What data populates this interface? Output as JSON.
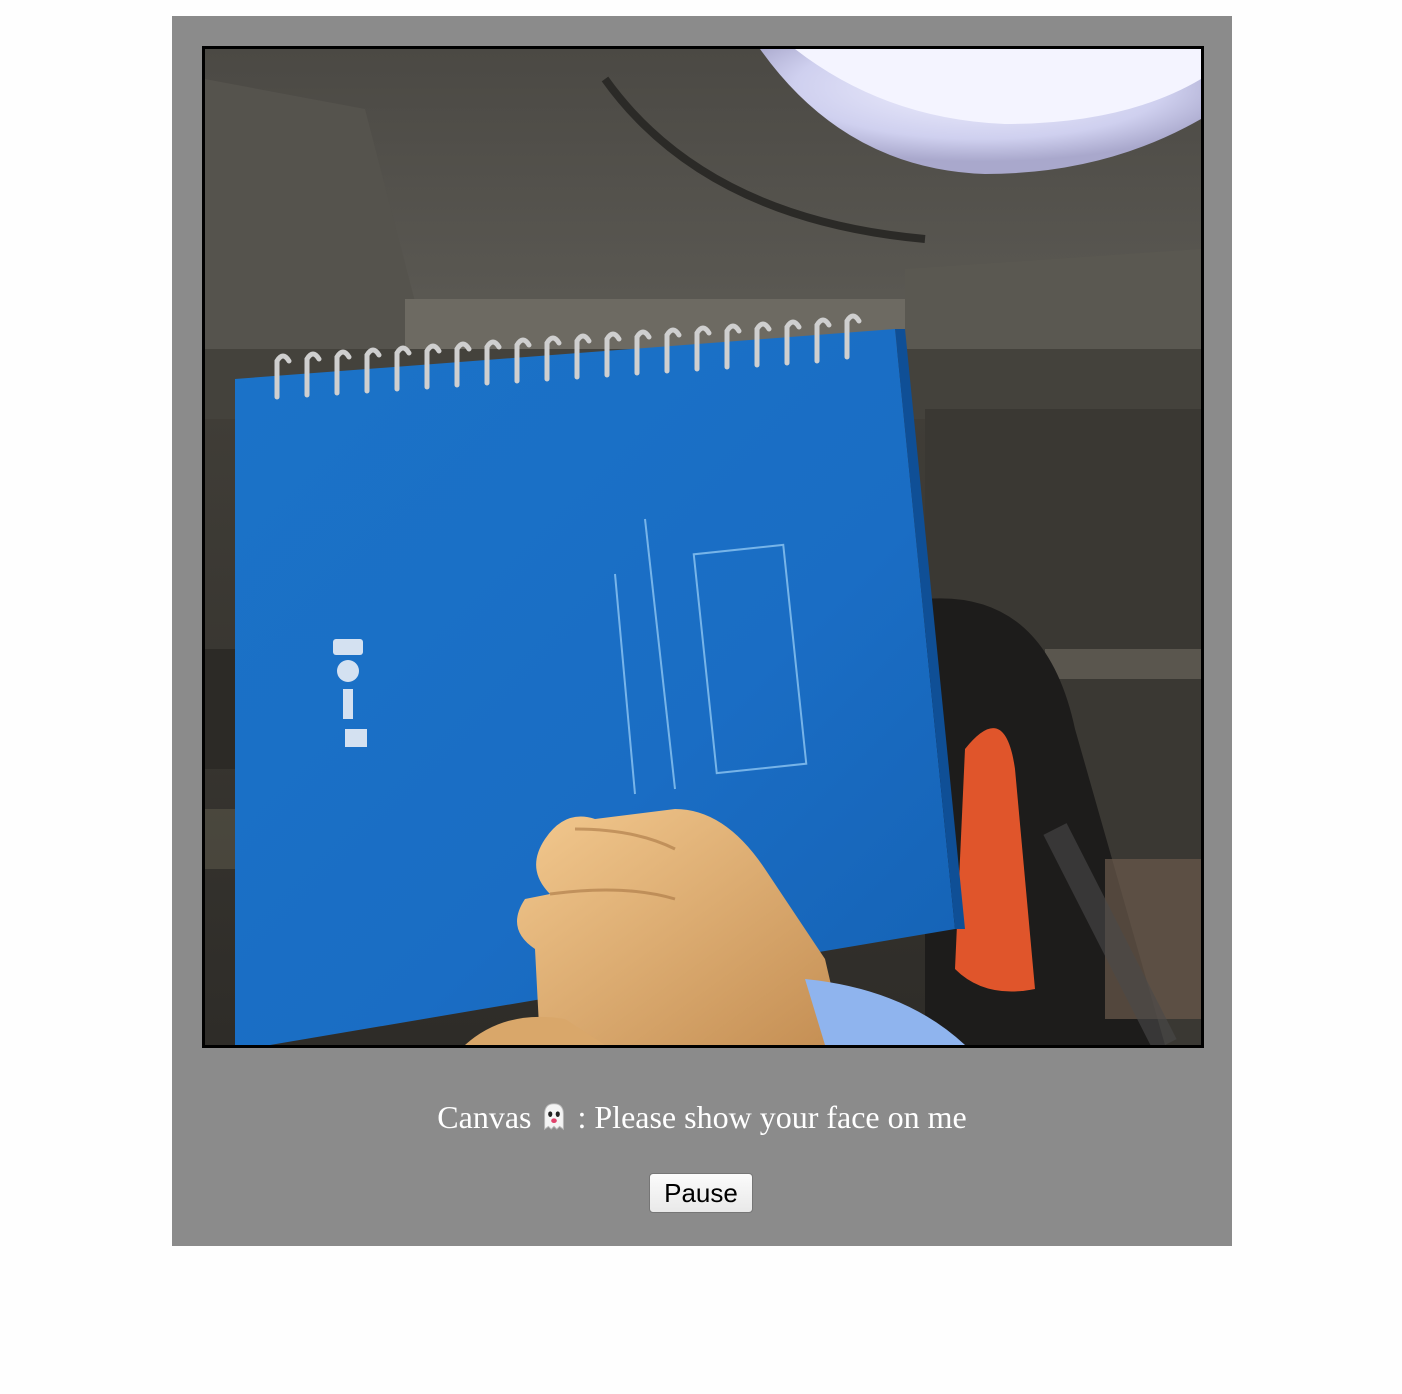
{
  "canvas": {
    "caption_prefix": "Canvas",
    "caption_icon": "ghost-icon",
    "caption_suffix": " : Please show your face on me"
  },
  "controls": {
    "pause_label": "Pause"
  },
  "colors": {
    "panel_bg": "#8b8b8b",
    "page_bg": "#fefefe",
    "notebook_blue": "#1a73c9"
  }
}
